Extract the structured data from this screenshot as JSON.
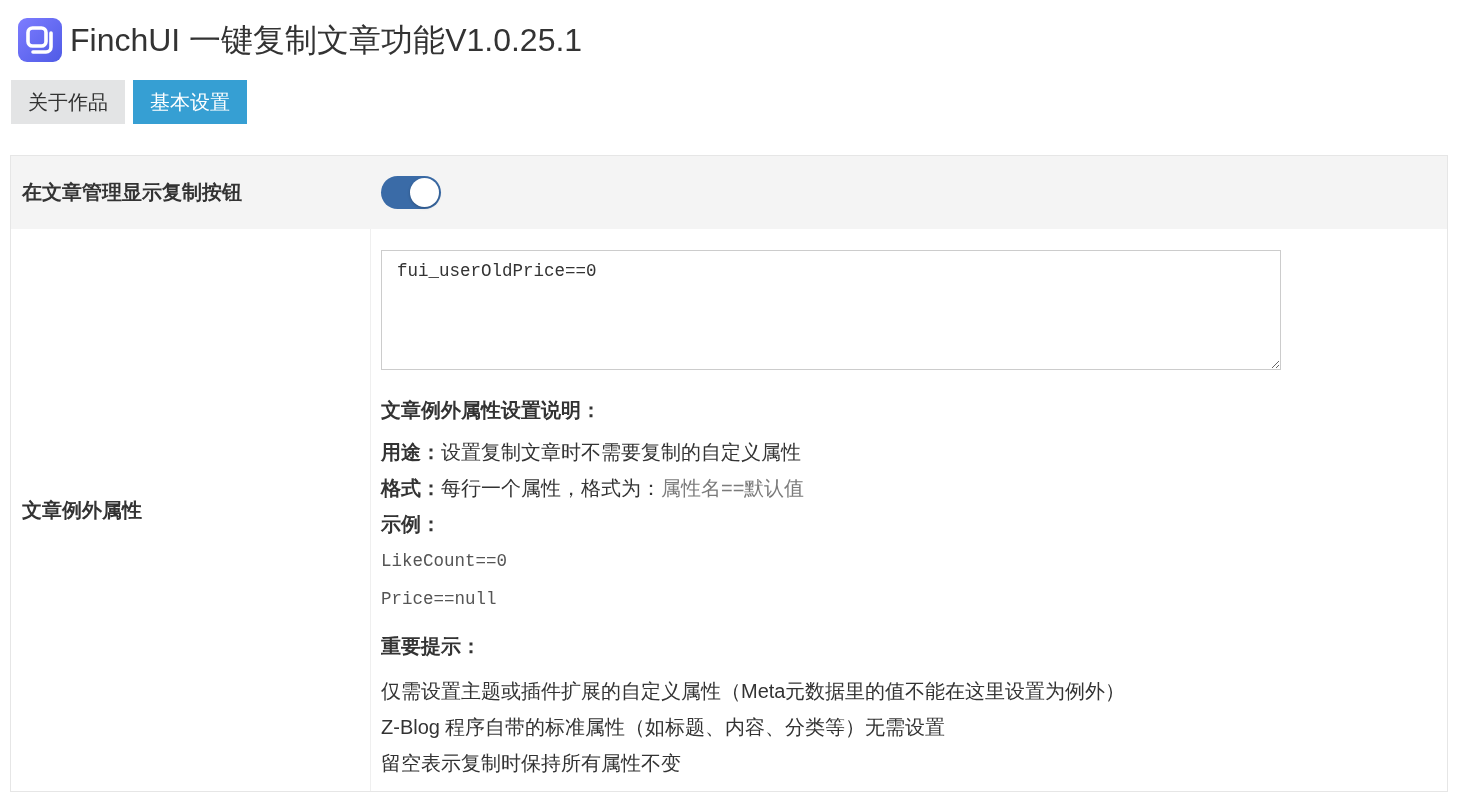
{
  "header": {
    "title": "FinchUI 一键复制文章功能V1.0.25.1"
  },
  "tabs": [
    {
      "label": "关于作品",
      "selected": false
    },
    {
      "label": "基本设置",
      "selected": true
    }
  ],
  "settings": [
    {
      "kind": "toggle",
      "label": "在文章管理显示复制按钮",
      "on": true
    },
    {
      "kind": "textarea",
      "label": "文章例外属性",
      "value": "fui_userOldPrice==0",
      "notes": [
        {
          "kind": "heading",
          "text": "文章例外属性设置说明："
        },
        {
          "kind": "text",
          "text": "**用途：**设置复制文章时不需要复制的自定义属性"
        },
        {
          "kind": "text",
          "text": "**格式：**每行一个属性，格式为：",
          "example": "属性名==默认值"
        },
        {
          "kind": "subheading",
          "text": "示例："
        },
        {
          "kind": "code",
          "text": "LikeCount==0"
        },
        {
          "kind": "code",
          "text": "Price==null"
        },
        {
          "kind": "heading",
          "text": "重要提示："
        },
        {
          "kind": "line",
          "text": "仅需设置主题或插件扩展的自定义属性（Meta元数据里的值不能在这里设置为例外）"
        },
        {
          "kind": "line",
          "text": "Z-Blog 程序自带的标准属性（如标题、内容、分类等）无需设置"
        },
        {
          "kind": "line",
          "text": "留空表示复制时保持所有属性不变"
        }
      ]
    }
  ]
}
